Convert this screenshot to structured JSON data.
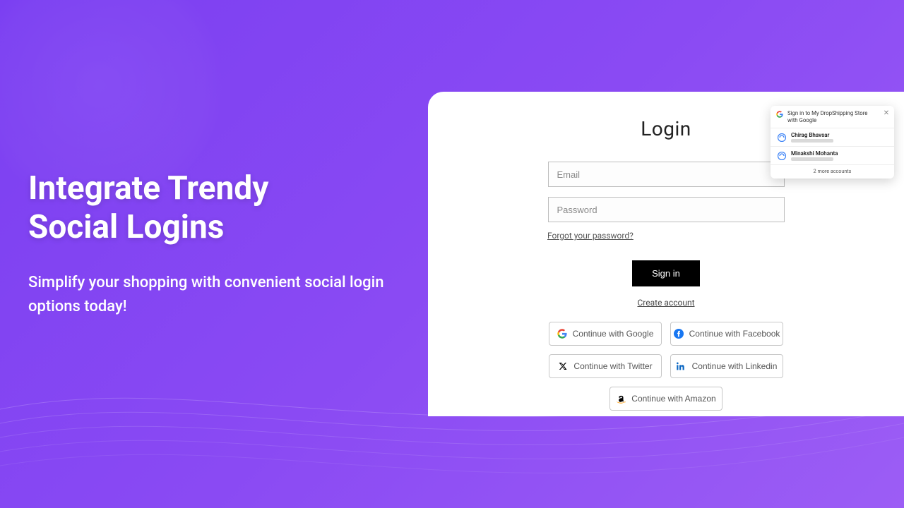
{
  "hero": {
    "title_line1": "Integrate Trendy",
    "title_line2": "Social Logins",
    "subtitle": "Simplify your shopping with convenient social login options today!"
  },
  "login": {
    "title": "Login",
    "email_placeholder": "Email",
    "password_placeholder": "Password",
    "forgot_label": "Forgot your password?",
    "signin_label": "Sign in",
    "create_label": "Create account",
    "social": {
      "google": "Continue with Google",
      "facebook": "Continue with Facebook",
      "twitter": "Continue with Twitter",
      "linkedin": "Continue with Linkedin",
      "amazon": "Continue with Amazon"
    }
  },
  "onetap": {
    "header": "Sign in to My DropShipping Store with Google",
    "accounts": [
      {
        "name": "Chirag Bhavsar"
      },
      {
        "name": "Minakshi Mohanta"
      }
    ],
    "more": "2 more accounts"
  }
}
